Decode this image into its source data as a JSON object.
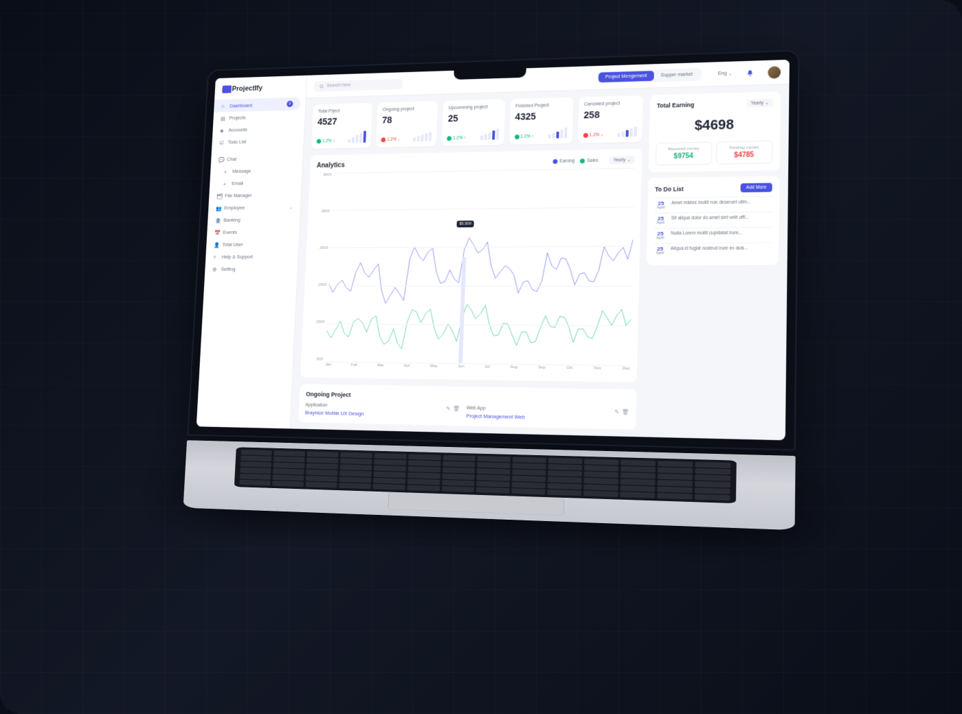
{
  "brand": "ProjectIfy",
  "search": {
    "placeholder": "Search here"
  },
  "sidebar": {
    "items": [
      {
        "label": "Dashboard",
        "badge": "2",
        "active": true
      },
      {
        "label": "Projects"
      },
      {
        "label": "Accounts"
      },
      {
        "label": "Todo List"
      },
      {
        "label": "Chat"
      },
      {
        "label": "Message",
        "sub": true
      },
      {
        "label": "Email",
        "sub": true
      },
      {
        "label": "File Manager"
      },
      {
        "label": "Employee",
        "chev": true
      },
      {
        "label": "Banking"
      },
      {
        "label": "Events"
      },
      {
        "label": "Total User"
      },
      {
        "label": "Help & Support"
      },
      {
        "label": "Setting"
      }
    ]
  },
  "tabs": [
    {
      "label": "Project Mengement",
      "active": true
    },
    {
      "label": "Supper market"
    }
  ],
  "lang": "Eng",
  "stats": [
    {
      "label": "Total Prject",
      "value": "4527",
      "delta": "1.2%",
      "dir": "up",
      "bars": [
        6,
        9,
        12,
        15,
        18
      ],
      "hl": 4
    },
    {
      "label": "Ongoing project",
      "value": "78",
      "delta": "1.2%",
      "dir": "down",
      "bars": [
        6,
        8,
        10,
        12,
        14
      ],
      "hl": -1
    },
    {
      "label": "Upcomming project",
      "value": "25",
      "delta": "1.2%",
      "dir": "up",
      "bars": [
        7,
        9,
        11,
        14,
        17
      ],
      "hl": 3
    },
    {
      "label": "Finished Project",
      "value": "4325",
      "delta": "1.2%",
      "dir": "up",
      "bars": [
        6,
        8,
        10,
        13,
        16
      ],
      "hl": 2
    },
    {
      "label": "Canceled project",
      "value": "258",
      "delta": "1.2%",
      "dir": "down",
      "bars": [
        6,
        8,
        10,
        12,
        15
      ],
      "hl": 2
    }
  ],
  "analytics": {
    "title": "Analytics",
    "legend": [
      {
        "label": "Earning",
        "color": "#4a52e0"
      },
      {
        "label": "Sales",
        "color": "#10b981"
      }
    ],
    "dropdown": "Yearly",
    "tooltip_value": "$5,500"
  },
  "chart_data": {
    "type": "line",
    "x_categories": [
      "Jan",
      "Feb",
      "Mar",
      "Apr",
      "May",
      "Jun",
      "Jul",
      "Aug",
      "Sep",
      "Oct",
      "Nov",
      "Dec"
    ],
    "y_ticks": [
      500,
      1000,
      1500,
      2000,
      2500,
      3000
    ],
    "ylim": [
      500,
      3000
    ],
    "series": [
      {
        "name": "Earning",
        "color": "#4a52e0",
        "values": [
          1500,
          1700,
          1400,
          1900,
          1600,
          2000,
          1700,
          1500,
          1800,
          1600,
          1900,
          2200
        ]
      },
      {
        "name": "Sales",
        "color": "#10b981",
        "values": [
          900,
          1000,
          800,
          1100,
          900,
          1150,
          950,
          850,
          1050,
          900,
          1100,
          1200
        ]
      }
    ],
    "highlight": {
      "month_index": 5,
      "label": "$5,500"
    }
  },
  "ongoing": {
    "title": "Ongoing Project",
    "items": [
      {
        "category": "Application",
        "name": "Braynice Mobile UX Design"
      },
      {
        "category": "Web App",
        "name": "Project Management Web"
      }
    ]
  },
  "earning": {
    "title": "Total Earning",
    "dropdown": "Yearly",
    "amount": "$4698",
    "received_label": "Received money",
    "received_value": "$9754",
    "pending_label": "Pending money",
    "pending_value": "$4785"
  },
  "todo": {
    "title": "To Do List",
    "add_label": "Add More",
    "items": [
      {
        "day": "25",
        "month": "April",
        "text": "Amet mistes mollit non deserunt ullm..."
      },
      {
        "day": "25",
        "month": "April",
        "text": "Sit aliqua dolor do amet sint velit offi..."
      },
      {
        "day": "25",
        "month": "April",
        "text": "Nulla Lorem mollit cupidatat irure..."
      },
      {
        "day": "25",
        "month": "April",
        "text": "Aliqua id fugiat nostrud irure ex duis..."
      }
    ]
  }
}
